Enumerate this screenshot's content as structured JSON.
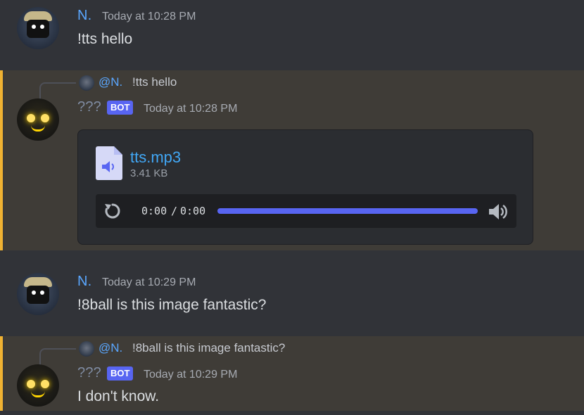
{
  "messages": [
    {
      "author": "N.",
      "timestamp": "Today at 10:28 PM",
      "content": "!tts hello"
    },
    {
      "reply": {
        "name": "@N.",
        "text": "!tts hello"
      },
      "author": "???",
      "badge": "BOT",
      "timestamp": "Today at 10:28 PM",
      "attachment": {
        "filename": "tts.mp3",
        "size": "3.41 KB",
        "player": {
          "current_time": "0:00",
          "separator": "/",
          "duration": "0:00",
          "progress_fraction": 1.0
        }
      }
    },
    {
      "author": "N.",
      "timestamp": "Today at 10:29 PM",
      "content": "!8ball is this image fantastic?"
    },
    {
      "reply": {
        "name": "@N.",
        "text": "!8ball is this image fantastic?"
      },
      "author": "???",
      "badge": "BOT",
      "timestamp": "Today at 10:29 PM",
      "content": "I don't know."
    }
  ],
  "icons": {
    "file": "audio-file-icon",
    "replay": "replay-icon",
    "volume": "volume-icon"
  },
  "colors": {
    "background": "#313338",
    "mention_highlight": "#3f3c37",
    "mention_border": "#f0b232",
    "user_name": "#5aa7ff",
    "bot_badge": "#5865f2",
    "link": "#41a7f5"
  }
}
